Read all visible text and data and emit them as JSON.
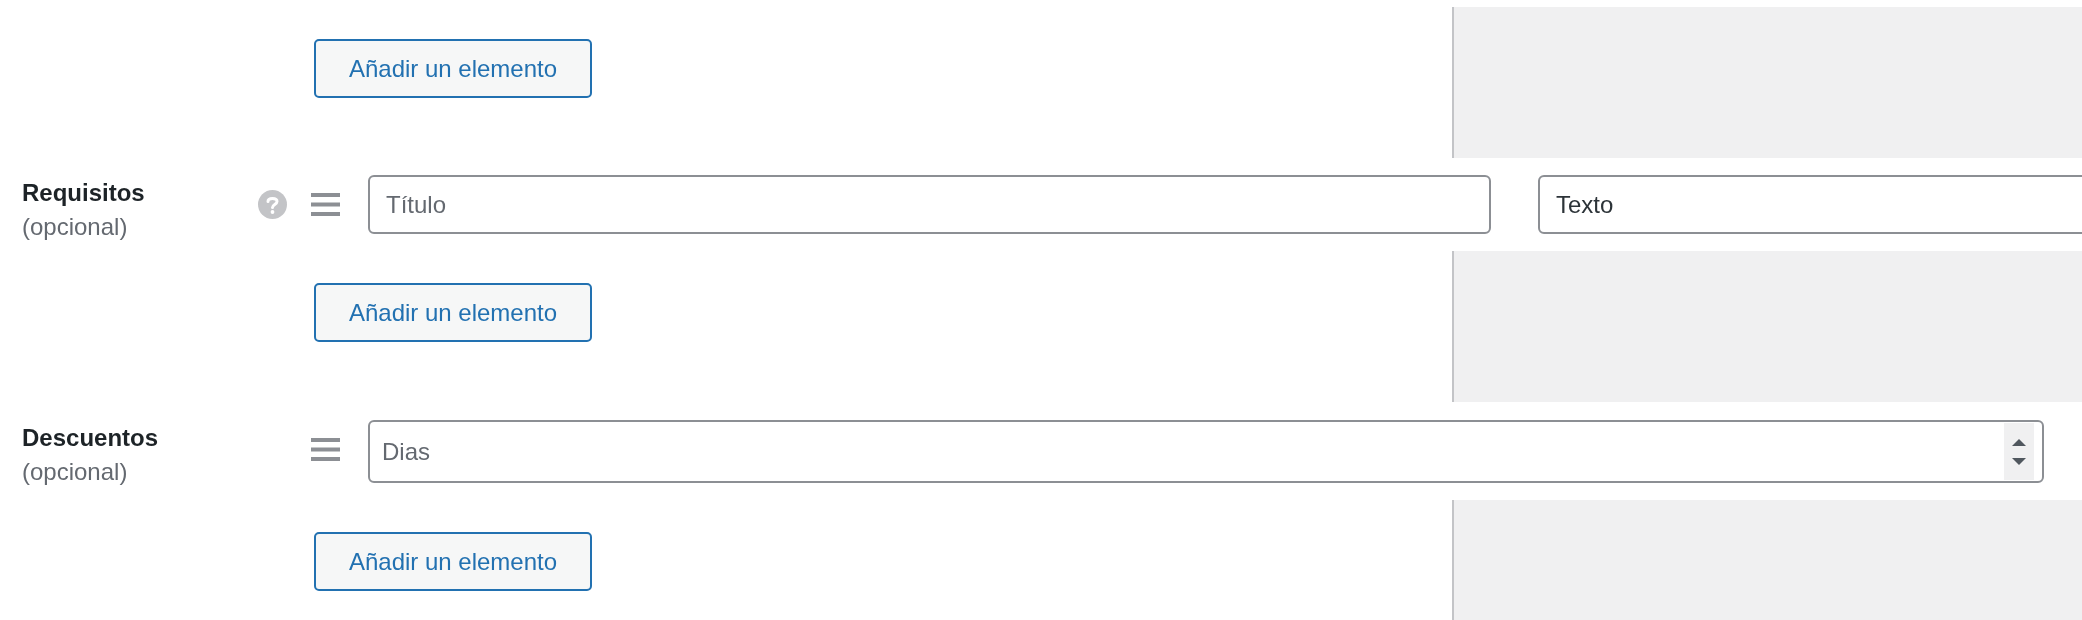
{
  "sections": [
    {
      "kind": "button_row",
      "button": "Añadir un elemento"
    },
    {
      "kind": "field_row",
      "label": "Requisitos",
      "note": "(opcional)",
      "help": true,
      "inputs": [
        {
          "kind": "text",
          "placeholder": "Título"
        },
        {
          "kind": "text",
          "value": "Texto"
        }
      ]
    },
    {
      "kind": "button_row",
      "button": "Añadir un elemento"
    },
    {
      "kind": "field_row",
      "label": "Descuentos",
      "note": "(opcional)",
      "help": false,
      "inputs": [
        {
          "kind": "number",
          "placeholder": "Dias"
        }
      ]
    },
    {
      "kind": "button_row",
      "button": "Añadir un elemento"
    }
  ]
}
